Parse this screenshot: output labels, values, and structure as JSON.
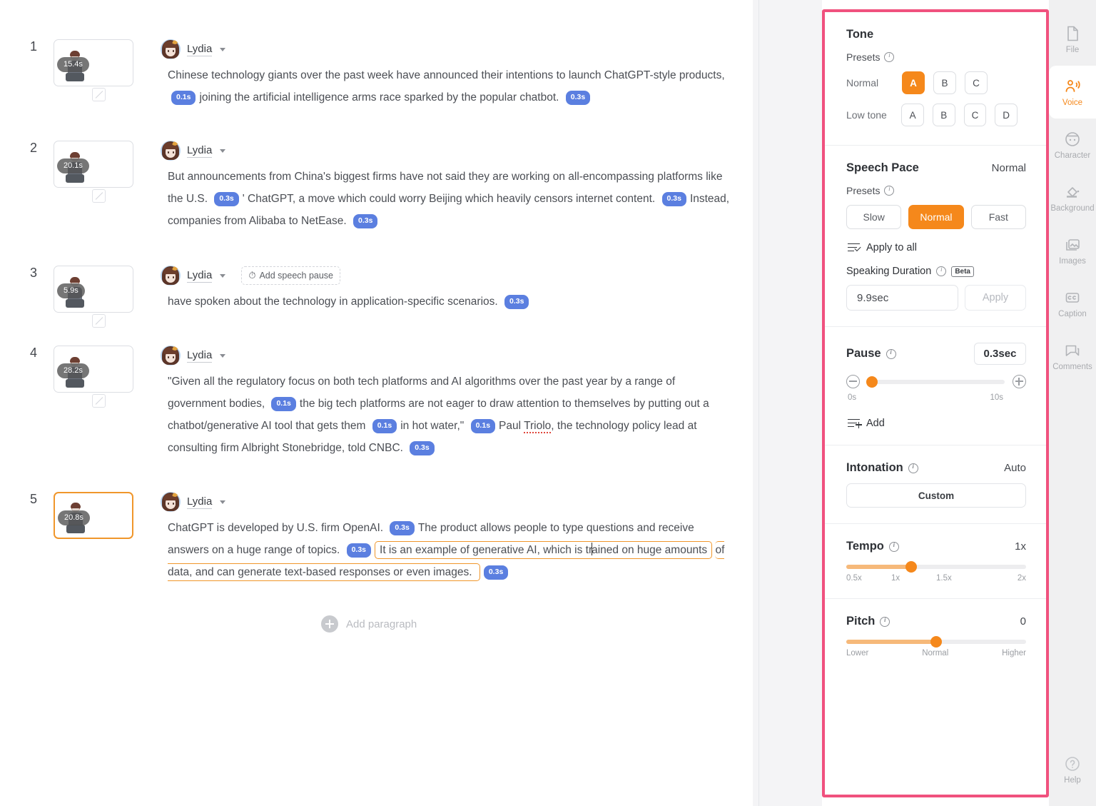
{
  "editor": {
    "add_paragraph_label": "Add paragraph",
    "speaker_name": "Lydia",
    "add_speech_pause_label": "Add speech pause",
    "paragraphs": [
      {
        "index": "1",
        "duration": "15.4s",
        "selected": false,
        "has_transition": true,
        "has_add_pause": false,
        "text": "Chinese technology giants over the past week have announced their intentions to launch ChatGPT-style products, ",
        "text_b": "joining the artificial intelligence arms race sparked by the popular chatbot. ",
        "chip_1": "0.1s",
        "chip_2": "0.3s"
      },
      {
        "index": "2",
        "duration": "20.1s",
        "selected": false,
        "has_transition": true,
        "has_add_pause": false,
        "text_a": "But announcements from China's biggest firms have not said they are working on all-encompassing platforms like the U.S. ",
        "chip_1": "0.3s",
        "text_b": "' ChatGPT, a move which could worry Beijing which heavily censors internet content. ",
        "chip_2": "0.3s",
        "text_c": "Instead, companies from Alibaba to NetEase. ",
        "chip_3": "0.3s"
      },
      {
        "index": "3",
        "duration": "5.9s",
        "selected": false,
        "has_transition": true,
        "has_add_pause": true,
        "text_a": "have spoken about the technology in application-specific scenarios. ",
        "chip_1": "0.3s"
      },
      {
        "index": "4",
        "duration": "28.2s",
        "selected": false,
        "has_transition": true,
        "has_add_pause": false,
        "text_a": "\"Given all the regulatory focus on both tech platforms and AI algorithms over the past year by a range of government bodies, ",
        "chip_1": "0.1s",
        "text_b": "the big tech platforms are not eager to draw attention to themselves by putting out a chatbot/generative AI tool that gets them ",
        "chip_2": "0.1s",
        "text_c": "in hot water,\" ",
        "chip_3": "0.1s",
        "text_d": "Paul ",
        "text_misspelled": "Triolo",
        "text_e": ", the technology policy lead at consulting firm Albright Stonebridge, told CNBC. ",
        "chip_4": "0.3s"
      },
      {
        "index": "5",
        "duration": "20.8s",
        "selected": true,
        "has_transition": false,
        "has_add_pause": false,
        "text_a": "ChatGPT is developed by U.S. firm OpenAI. ",
        "chip_1": "0.3s",
        "text_b": "The product allows people to type questions and receive answers on a huge range of topics. ",
        "chip_2": "0.3s",
        "selected_text_1": "It is an example of generative AI, which is tr",
        "selected_text_2": "ained on huge amounts",
        "selected_text_3": "of data, and can generate text-based responses or even images. ",
        "chip_3": "0.3s"
      }
    ]
  },
  "panel": {
    "tone": {
      "title": "Tone",
      "presets_label": "Presets",
      "normal_label": "Normal",
      "low_tone_label": "Low tone",
      "normal_options": [
        "A",
        "B",
        "C"
      ],
      "normal_selected": "A",
      "low_tone_options": [
        "A",
        "B",
        "C",
        "D"
      ],
      "low_tone_selected": ""
    },
    "speech_pace": {
      "title": "Speech Pace",
      "value": "Normal",
      "presets_label": "Presets",
      "options": [
        "Slow",
        "Normal",
        "Fast"
      ],
      "selected": "Normal",
      "apply_to_all_label": "Apply to all",
      "speaking_duration_label": "Speaking Duration",
      "beta_badge": "Beta",
      "duration_value": "9.9sec",
      "apply_label": "Apply"
    },
    "pause": {
      "title": "Pause",
      "value": "0.3sec",
      "min_label": "0s",
      "max_label": "10s",
      "knob_percent": 3,
      "add_label": "Add"
    },
    "intonation": {
      "title": "Intonation",
      "value": "Auto",
      "custom_label": "Custom"
    },
    "tempo": {
      "title": "Tempo",
      "value": "1x",
      "ticks": [
        "0.5x",
        "1x",
        "1.5x",
        "2x"
      ],
      "knob_percent": 36
    },
    "pitch": {
      "title": "Pitch",
      "value": "0",
      "ticks": [
        "Lower",
        "Normal",
        "Higher"
      ],
      "knob_percent": 50
    }
  },
  "rail": {
    "items": [
      {
        "label": "File",
        "icon": "file-icon",
        "active": false
      },
      {
        "label": "Voice",
        "icon": "voice-icon",
        "active": true
      },
      {
        "label": "Character",
        "icon": "character-icon",
        "active": false
      },
      {
        "label": "Background",
        "icon": "background-icon",
        "active": false
      },
      {
        "label": "Images",
        "icon": "images-icon",
        "active": false
      },
      {
        "label": "Caption",
        "icon": "caption-icon",
        "active": false
      },
      {
        "label": "Comments",
        "icon": "comments-icon",
        "active": false
      }
    ],
    "help_label": "Help"
  },
  "colors": {
    "accent_orange": "#f5881b",
    "pause_chip_blue": "#5b7fe0",
    "annotation_pink": "#f0517e"
  }
}
